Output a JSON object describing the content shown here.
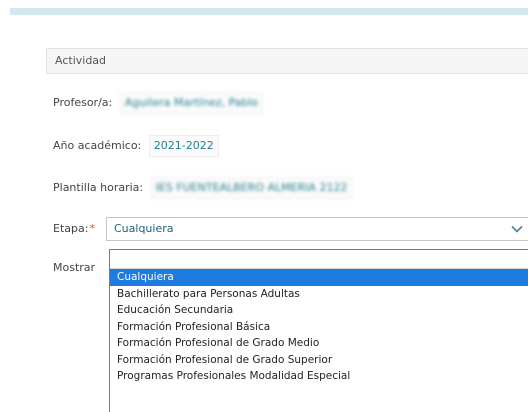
{
  "section": {
    "title": "Actividad"
  },
  "fields": {
    "profesor": {
      "label": "Profesor/a:",
      "value": "Aguilera Martínez, Pablo"
    },
    "ano": {
      "label": "Año académico:",
      "value": "2021-2022"
    },
    "plantilla": {
      "label": "Plantilla horaria:",
      "value": "IES FUENTEALBERO ALMERIA 2122"
    }
  },
  "etapa": {
    "label": "Etapa:",
    "required_mark": "*",
    "selected": "Cualquiera"
  },
  "mostrar": {
    "label": "Mostrar"
  },
  "dropdown": {
    "search_value": "",
    "options": [
      "Cualquiera",
      "Bachillerato para Personas Adultas",
      "Educación Secundaria",
      "Formación Profesional Básica",
      "Formación Profesional de Grado Medio",
      "Formación Profesional de Grado Superior",
      "Programas Profesionales Modalidad Especial"
    ],
    "highlighted_index": 0
  },
  "colors": {
    "accent": "#1f7f8e",
    "highlight": "#1e7be0",
    "required": "#e0531e",
    "top_band": "#cfe9ec"
  }
}
